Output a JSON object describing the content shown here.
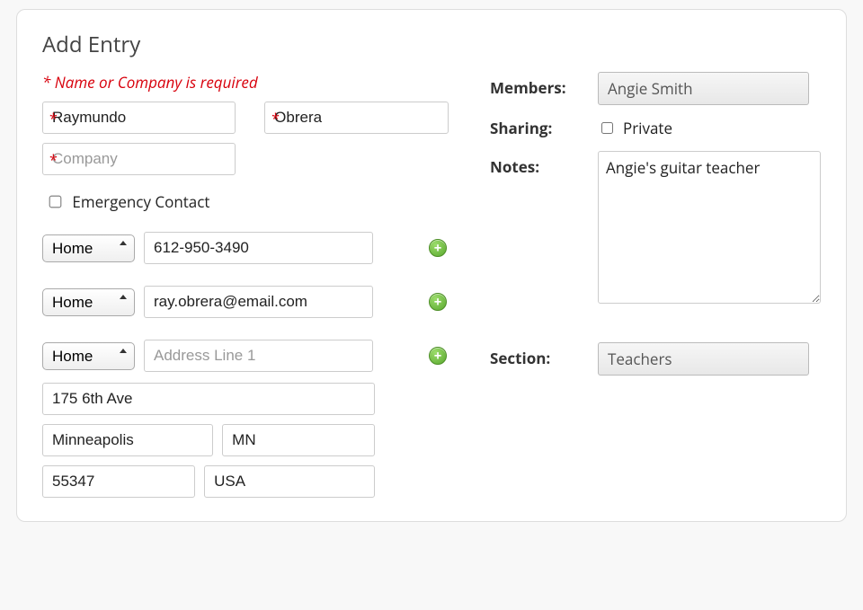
{
  "title": "Add Entry",
  "required_message": "* Name or Company is required",
  "name": {
    "first": "Raymundo",
    "last": "Obrera",
    "first_placeholder": "",
    "last_placeholder": ""
  },
  "company": {
    "value": "",
    "placeholder": "Company"
  },
  "emergency": {
    "label": "Emergency Contact",
    "checked": false
  },
  "type_options": [
    "Home"
  ],
  "phone": {
    "type": "Home",
    "value": "612-950-3490"
  },
  "email": {
    "type": "Home",
    "value": "ray.obrera@email.com"
  },
  "address": {
    "type": "Home",
    "line1": "",
    "line1_placeholder": "Address Line 1",
    "line2": "175 6th Ave",
    "city": "Minneapolis",
    "state": "MN",
    "zip": "55347",
    "country": "USA"
  },
  "members": {
    "label": "Members:",
    "value": "Angie Smith"
  },
  "sharing": {
    "label": "Sharing:",
    "private_label": "Private",
    "private_checked": false
  },
  "notes": {
    "label": "Notes:",
    "value": "Angie's guitar teacher"
  },
  "section": {
    "label": "Section:",
    "value": "Teachers"
  }
}
